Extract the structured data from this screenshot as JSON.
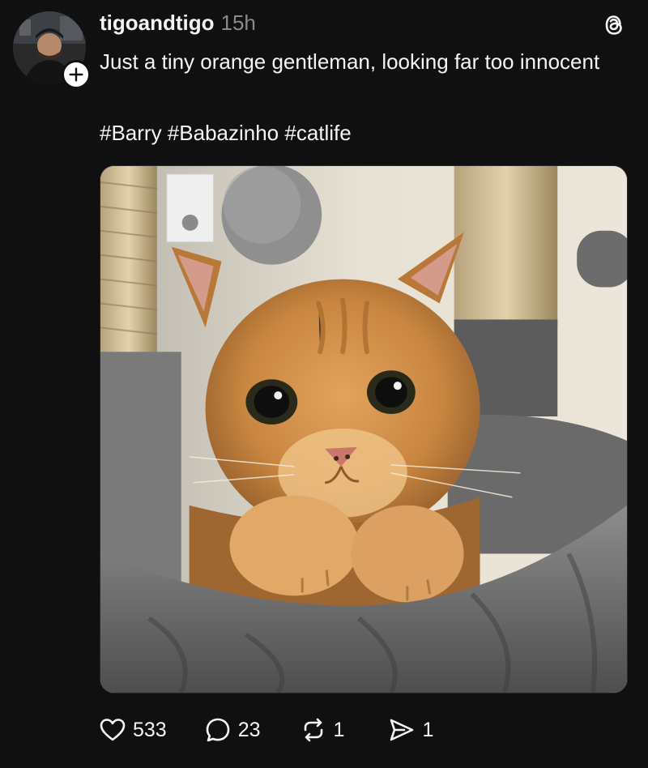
{
  "post": {
    "username": "tigoandtigo",
    "timestamp": "15h",
    "caption": "Just a tiny orange gentleman, looking far too innocent",
    "hashtags": "#Barry #Babazinho #catlife",
    "image_description_icon": "cat-photo"
  },
  "actions": {
    "likes": "533",
    "replies": "23",
    "reposts": "1",
    "shares": "1"
  },
  "icons": {
    "avatar": "avatar-icon",
    "follow": "plus-icon",
    "app_logo": "threads-logo-icon",
    "like": "heart-icon",
    "reply": "speech-bubble-icon",
    "repost": "repost-icon",
    "share": "send-icon"
  },
  "colors": {
    "background": "#101010",
    "text": "#f3f5f7",
    "muted": "#8a8a8a"
  }
}
